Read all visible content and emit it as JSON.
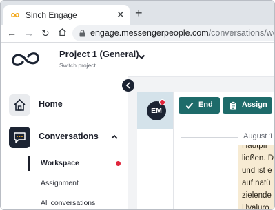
{
  "browser": {
    "tab_title": "Sinch Engage",
    "url_host": "engage.messengerpeople.com",
    "url_path": "/conversations/workspa"
  },
  "header": {
    "project_name": "Project 1 (General)",
    "project_sub": "Switch project"
  },
  "sidebar": {
    "items": [
      {
        "label": "Home",
        "icon": "home-icon"
      },
      {
        "label": "Conversations",
        "icon": "chat-bubble-icon"
      }
    ],
    "subitems": [
      {
        "label": "Workspace",
        "active": true,
        "unread": true
      },
      {
        "label": "Assignment"
      },
      {
        "label": "All conversations"
      }
    ]
  },
  "conversation": {
    "avatar_initials": "EM",
    "end_label": "End",
    "assign_label": "Assign",
    "date_label": "August 1",
    "message_lines": [
      "Hautpfl",
      "ließen. D",
      "und ist e",
      "auf natü",
      "zielende",
      "Hyaluro"
    ]
  },
  "colors": {
    "accent": "#1e6b6a",
    "dark": "#1c2433",
    "alert": "#e0253b",
    "bubble": "#f7ebd3"
  }
}
